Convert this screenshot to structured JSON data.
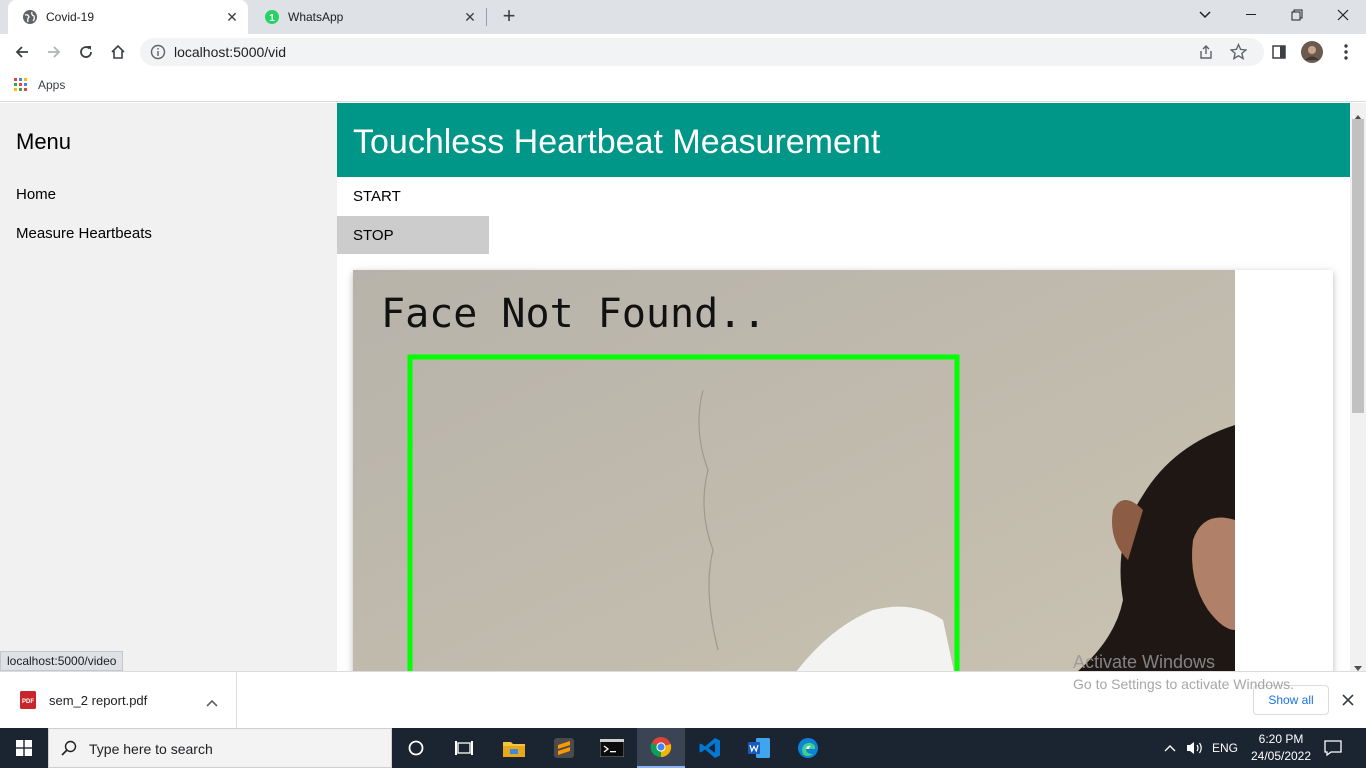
{
  "browser": {
    "tabs": [
      {
        "title": "Covid-19",
        "active": true,
        "icon": "globe-icon"
      },
      {
        "title": "WhatsApp",
        "active": false,
        "icon": "whatsapp-icon",
        "badge": "1"
      }
    ],
    "address": "localhost:5000/vid",
    "bookmarks": {
      "apps_label": "Apps"
    },
    "status_url": "localhost:5000/video"
  },
  "page": {
    "sidebar": {
      "title": "Menu",
      "items": [
        {
          "label": "Home"
        },
        {
          "label": "Measure Heartbeats"
        }
      ]
    },
    "header": {
      "title": "Touchless Heartbeat Measurement",
      "color": "#009688"
    },
    "controls": {
      "start_label": "START",
      "stop_label": "STOP"
    },
    "video": {
      "overlay_text": "Face Not Found..",
      "box_color": "#00ff00"
    }
  },
  "downloads": {
    "file_name": "sem_2 report.pdf",
    "file_type_label": "PDF",
    "show_all_label": "Show all"
  },
  "watermark": {
    "line1": "Activate Windows",
    "line2": "Go to Settings to activate Windows."
  },
  "taskbar": {
    "search_placeholder": "Type here to search",
    "language": "ENG",
    "time": "6:20 PM",
    "date": "24/05/2022"
  }
}
